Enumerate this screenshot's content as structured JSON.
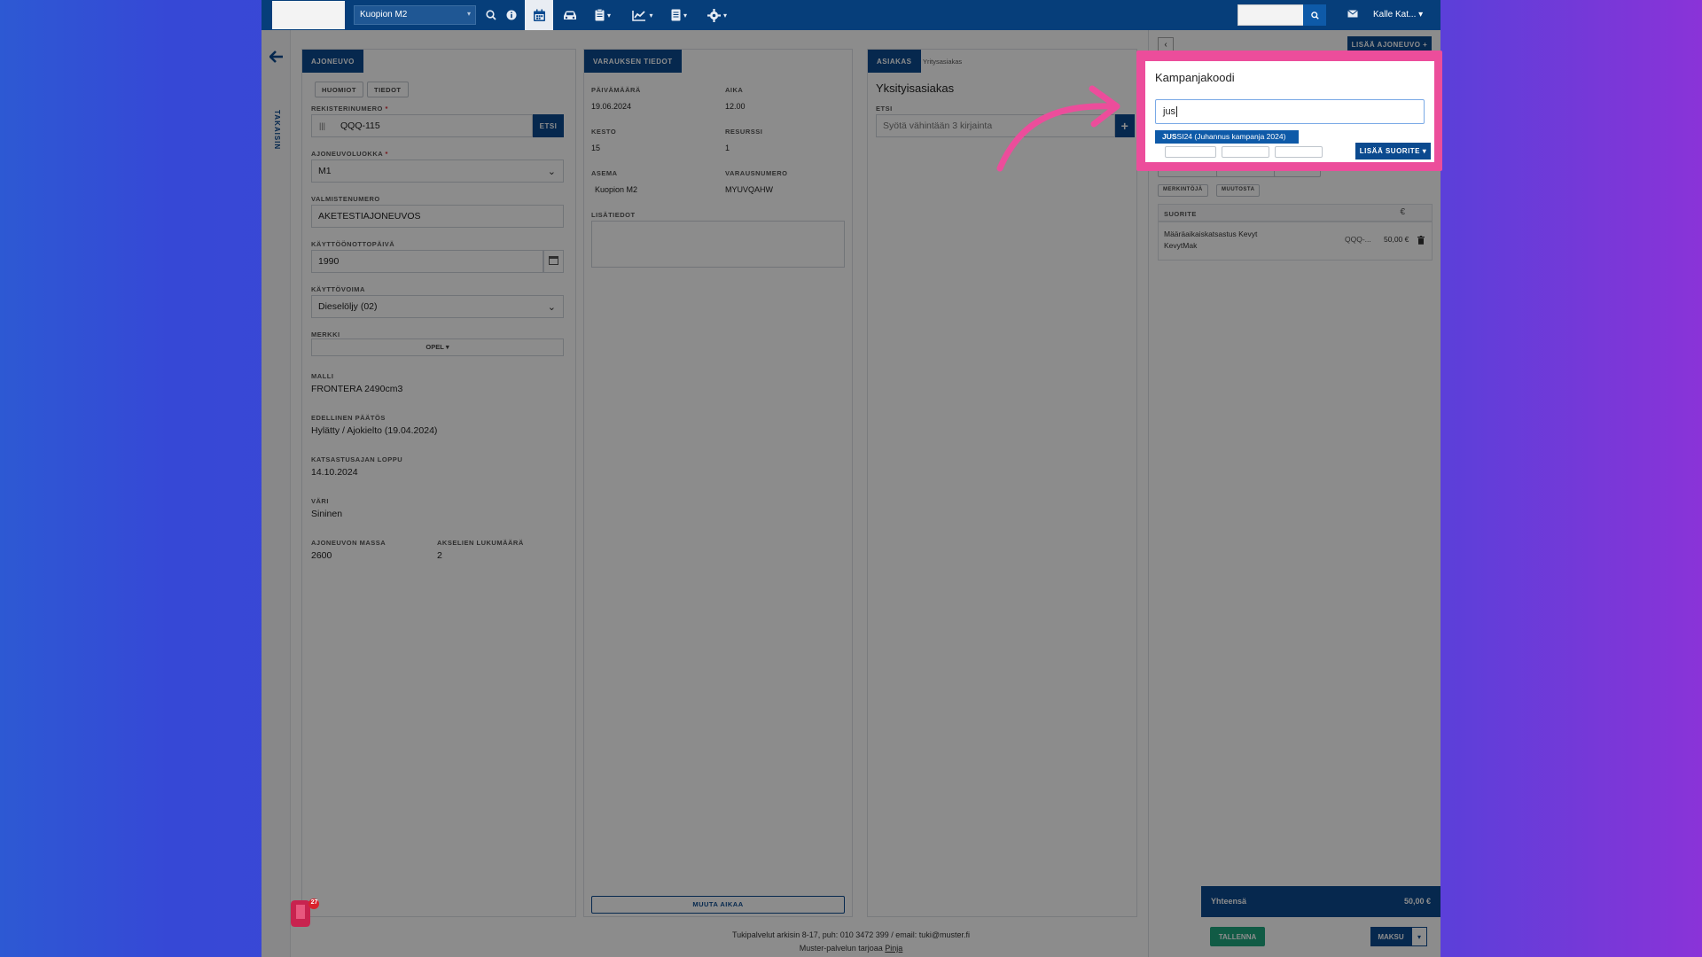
{
  "topbar": {
    "location": "Kuopion M2",
    "user": "Kalle Kat...",
    "icons": [
      "search-icon",
      "info-icon",
      "calendar-icon",
      "car-icon",
      "clipboard-icon",
      "chart-icon",
      "document-icon",
      "gear-icon"
    ]
  },
  "left_rail": {
    "back_label": "TAKAISIN"
  },
  "vehicle": {
    "tab": "AJONEUVO",
    "buttons": {
      "notes": "HUOMIOT",
      "info": "TIEDOT"
    },
    "reg_label": "REKISTERINUMERO",
    "reg_value": "QQQ-115",
    "search_btn": "ETSI",
    "class_label": "AJONEUVOLUOKKA",
    "class_value": "M1",
    "make_num_label": "VALMISTENUMERO",
    "make_num_value": "AKETESTIAJONEUVOS",
    "date_label": "KÄYTTÖÖNOTTOPÄIVÄ",
    "date_value": "1990",
    "fuel_label": "KÄYTTÖVOIMA",
    "fuel_value": "Dieselöljy (02)",
    "brand_label": "MERKKI",
    "brand_value": "OPEL",
    "model_label": "MALLI",
    "model_value": "FRONTERA 2490cm3",
    "prev_label": "EDELLINEN PÄÄTÖS",
    "prev_value": "Hylätty / Ajokielto (19.04.2024)",
    "end_label": "KATSASTUSAJAN LOPPU",
    "end_value": "14.10.2024",
    "color_label": "VÄRI",
    "color_value": "Sininen",
    "mass_label": "AJONEUVON MASSA",
    "mass_value": "2600",
    "axles_label": "AKSELIEN LUKUMÄÄRÄ",
    "axles_value": "2"
  },
  "booking": {
    "tab": "VARAUKSEN TIEDOT",
    "date_label": "PÄIVÄMÄÄRÄ",
    "date_value": "19.06.2024",
    "time_label": "AIKA",
    "time_value": "12.00",
    "duration_label": "KESTO",
    "duration_value": "15",
    "resource_label": "RESURSSI",
    "resource_value": "1",
    "station_label": "ASEMA",
    "station_value": "Kuopion M2",
    "booking_no_label": "VARAUSNUMERO",
    "booking_no_value": "MYUVQAHW",
    "extra_label": "LISÄTIEDOT",
    "change_time_btn": "MUUTA AIKAA"
  },
  "customer": {
    "tab": "ASIAKAS",
    "tab2": "Yritysasiakas",
    "title": "Yksityisasiakas",
    "search_label": "ETSI",
    "search_placeholder": "Syötä vähintään 3 kirjainta"
  },
  "right_panel": {
    "add_vehicle_btn": "LISÄÄ AJONEUVO",
    "service_label": "SUORITE",
    "service_name": "Määräaikaiskatsastus Kevyt KevytMak",
    "service_reg": "QQQ-...",
    "service_price": "50,00 €",
    "total_label": "Yhteensä",
    "total_value": "50,00 €",
    "save_btn": "TALLENNA",
    "pay_btn": "MAKSU"
  },
  "popup": {
    "title": "Kampanjakoodi",
    "input_value": "jus",
    "suggestion_match": "JUS",
    "suggestion_rest": "SI24 (Juhannus kampanja 2024)",
    "add_btn": "LISÄÄ SUORITE"
  },
  "footer": {
    "line1": "Tukipalvelut arkisin 8-17, puh: 010 3472 399 / email: tuki@muster.fi",
    "line2_prefix": "Muster-palvelun tarjoaa",
    "line2_link": "Pinja"
  },
  "badge_count": "27",
  "colors": {
    "brand": "#0b4a8f",
    "highlight": "#ec4d9b",
    "success": "#1fa67f"
  }
}
